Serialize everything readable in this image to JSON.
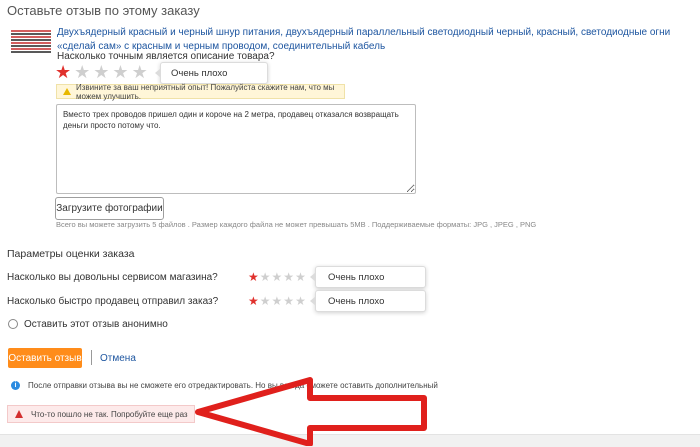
{
  "page": {
    "title": "Оставьте отзыв по этому заказу"
  },
  "product": {
    "name": "Двухъядерный красный и черный шнур питания, двухъядерный параллельный светодиодный черный, красный, светодиодные огни «сделай сам» с красным и черным проводом, соединительный кабель",
    "thumbnail_icon": "cable-thumbnail-icon"
  },
  "description_rating": {
    "question": "Насколько точным является описание товара?",
    "rating": 1,
    "max": 5,
    "tooltip": "Очень плохо"
  },
  "apology": {
    "text": "Извините за ваш неприятный опыт! Пожалуйста скажите нам, что мы можем улучшить.",
    "icon": "warning-icon"
  },
  "review": {
    "text": "Вместо трех проводов пришел один и короче на 2 метра, продавец отказался возвращать деньги просто потому что."
  },
  "upload": {
    "button_label": "Загрузите фотографии",
    "hint": "Всего вы можете загрузить 5 файлов . Размер каждого файла не может превышать 5MB . Поддерживаемые форматы: JPG , JPEG , PNG"
  },
  "params": {
    "title": "Параметры оценки заказа",
    "items": [
      {
        "label": "Насколько вы довольны сервисом магазина?",
        "rating": 1,
        "max": 5,
        "tooltip": "Очень плохо"
      },
      {
        "label": "Насколько быстро продавец отправил заказ?",
        "rating": 1,
        "max": 5,
        "tooltip": "Очень плохо"
      }
    ]
  },
  "anonymous": {
    "label": "Оставить этот отзыв анонимно",
    "checked": false
  },
  "actions": {
    "submit_label": "Оставить отзыв",
    "cancel_label": "Отмена"
  },
  "info": {
    "text": "После отправки отзыва вы не сможете его отредактировать. Но вы всегда сможете оставить дополнительный",
    "icon": "info-icon"
  },
  "error": {
    "text": "Что-то пошло не так. Попробуйте еще раз",
    "icon": "warning-icon"
  },
  "colors": {
    "accent_orange": "#ff8c1a",
    "star_active": "#e0312d",
    "link_blue": "#1e56a0",
    "annotation_arrow": "#e0201c"
  }
}
